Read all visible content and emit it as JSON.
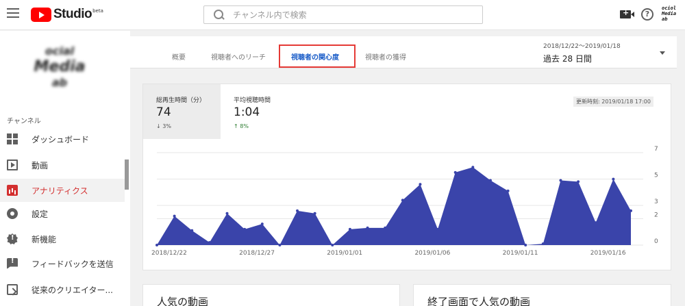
{
  "app": {
    "logo_text": "Studio",
    "logo_beta": "beta",
    "avatar_text": [
      "ociol",
      "Media",
      "ab"
    ]
  },
  "search": {
    "placeholder": "チャンネル内で検索"
  },
  "sidebar": {
    "avatar_text": [
      "ocial",
      "Media",
      "ab"
    ],
    "section_title": "チャンネル",
    "items": [
      {
        "label": "ダッシュボード",
        "icon": "dashboard-icon"
      },
      {
        "label": "動画",
        "icon": "video-icon"
      },
      {
        "label": "アナリティクス",
        "icon": "analytics-icon",
        "active": true
      },
      {
        "label": "設定",
        "icon": "gear-icon"
      },
      {
        "label": "新機能",
        "icon": "whats-new-icon"
      },
      {
        "label": "フィードバックを送信",
        "icon": "feedback-icon"
      },
      {
        "label": "従来のクリエイター...",
        "icon": "classic-studio-icon"
      }
    ]
  },
  "tabs": [
    {
      "label": "概要"
    },
    {
      "label": "視聴者へのリーチ"
    },
    {
      "label": "視聴者の関心度",
      "active": true
    },
    {
      "label": "視聴者の獲得"
    }
  ],
  "period": {
    "range": "2018/12/22〜2019/01/18",
    "label": "過去 28 日間"
  },
  "metrics": [
    {
      "label": "総再生時間（分）",
      "value": "74",
      "delta": "3%",
      "direction": "down"
    },
    {
      "label": "平均視聴時間",
      "value": "1:04",
      "delta": "8%",
      "direction": "up"
    }
  ],
  "updated": "更新時刻: 2019/01/18 17:00",
  "colors": {
    "chart_fill": "#3a44aa",
    "accent_red": "#d32f2f",
    "tab_active": "#1a5dc8"
  },
  "chart_data": {
    "type": "area",
    "x": [
      "2018/12/22",
      "2018/12/23",
      "2018/12/24",
      "2018/12/25",
      "2018/12/26",
      "2018/12/27",
      "2018/12/28",
      "2018/12/29",
      "2018/12/30",
      "2018/12/31",
      "2019/01/01",
      "2019/01/02",
      "2019/01/03",
      "2019/01/04",
      "2019/01/05",
      "2019/01/06",
      "2019/01/07",
      "2019/01/08",
      "2019/01/09",
      "2019/01/10",
      "2019/01/11",
      "2019/01/12",
      "2019/01/13",
      "2019/01/14",
      "2019/01/15",
      "2019/01/16",
      "2019/01/17",
      "2019/01/18"
    ],
    "values": [
      0,
      2.2,
      1.1,
      0.2,
      2.4,
      1.2,
      1.6,
      0,
      2.6,
      2.4,
      0,
      1.2,
      1.3,
      1.3,
      3.4,
      4.6,
      1.2,
      5.5,
      5.9,
      4.9,
      4.1,
      0,
      0.1,
      4.9,
      4.8,
      1.7,
      5.0,
      2.6
    ],
    "x_ticks": [
      "2018/12/22",
      "2018/12/27",
      "2019/01/01",
      "2019/01/06",
      "2019/01/11",
      "2019/01/16"
    ],
    "y_ticks": [
      "0",
      "2",
      "3",
      "5",
      "7"
    ],
    "ylim": [
      0,
      7
    ],
    "grid": true
  },
  "bottom_cards": [
    {
      "title": "人気の動画"
    },
    {
      "title": "終了画面で人気の動画"
    }
  ]
}
